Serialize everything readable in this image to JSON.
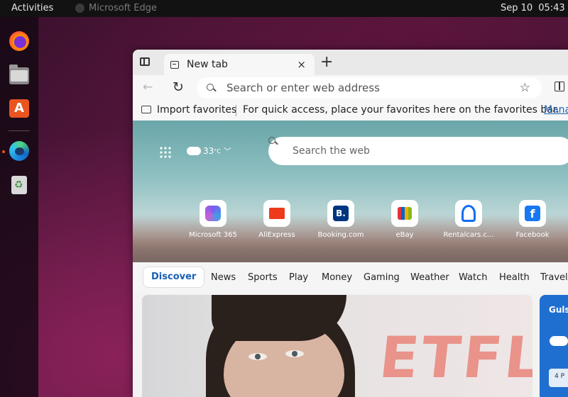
{
  "topbar": {
    "activities": "Activities",
    "app_name": "Microsoft Edge",
    "date": "Sep 10",
    "time": "05:43"
  },
  "dock": {
    "items": [
      {
        "name": "Firefox",
        "icon": "firefox-icon"
      },
      {
        "name": "Files",
        "icon": "files-icon"
      },
      {
        "name": "Ubuntu Software",
        "icon": "app-store-icon"
      },
      {
        "name": "Microsoft Edge",
        "icon": "edge-icon",
        "running": true
      },
      {
        "name": "Trash",
        "icon": "trash-icon"
      }
    ]
  },
  "browser": {
    "tab": {
      "title": "New tab",
      "close": "×"
    },
    "new_tab": "+",
    "address_placeholder": "Search or enter web address",
    "favorites_bar": {
      "import": "Import favorites",
      "hint": "For quick access, place your favorites here on the favorites bar.",
      "manage": "Manage"
    }
  },
  "newtab_page": {
    "weather": {
      "temp": "33",
      "unit": "°C"
    },
    "search_placeholder": "Search the web",
    "quick_links": [
      {
        "label": "Microsoft 365"
      },
      {
        "label": "AliExpress"
      },
      {
        "label": "Booking.com"
      },
      {
        "label": "eBay"
      },
      {
        "label": "Rentalcars.c..."
      },
      {
        "label": "Facebook"
      }
    ],
    "feed_nav": [
      "Discover",
      "News",
      "Sports",
      "Play",
      "Money",
      "Gaming",
      "Weather",
      "Watch",
      "Health",
      "Travel"
    ],
    "side_card": {
      "city": "Guls",
      "mini": "4 P"
    },
    "main_card_bg_text": "ETFL"
  },
  "colors": {
    "accent_link": "#1a5fb4",
    "ubuntu_orange": "#e95420",
    "topbar": "#121212"
  }
}
